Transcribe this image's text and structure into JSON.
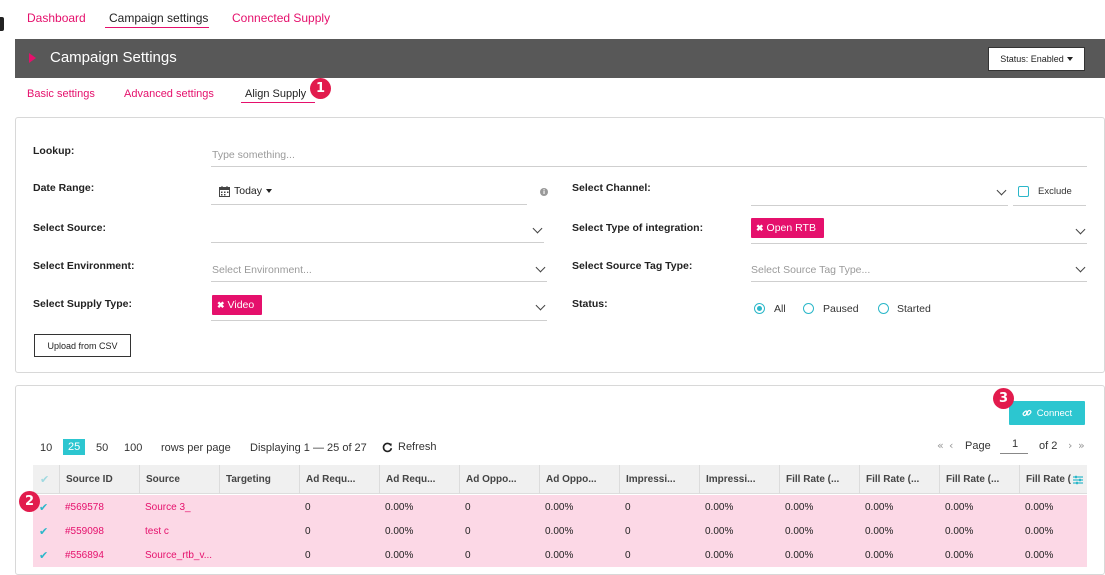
{
  "top_nav": {
    "dashboard": "Dashboard",
    "campaign_settings": "Campaign settings",
    "connected_supply": "Connected Supply"
  },
  "header": {
    "title": "Campaign Settings",
    "status_button": "Status: Enabled"
  },
  "sub_tabs": {
    "basic": "Basic settings",
    "advanced": "Advanced settings",
    "align_supply": "Align Supply"
  },
  "markers": {
    "m1": "1",
    "m2": "2",
    "m3": "3"
  },
  "filters": {
    "lookup_label": "Lookup:",
    "lookup_placeholder": "Type something...",
    "date_range_label": "Date Range:",
    "date_range_value": "Today",
    "select_source_label": "Select Source:",
    "select_environment_label": "Select Environment:",
    "select_environment_placeholder": "Select Environment...",
    "select_supply_type_label": "Select Supply Type:",
    "supply_type_tag": "Video",
    "select_channel_label": "Select Channel:",
    "exclude_label": "Exclude",
    "select_integration_label": "Select Type of integration:",
    "integration_tag": "Open RTB",
    "select_source_tag_type_label": "Select Source Tag Type:",
    "select_source_tag_type_placeholder": "Select Source Tag Type...",
    "status_label": "Status:",
    "status_options": [
      "All",
      "Paused",
      "Started"
    ],
    "status_selected": "All",
    "upload_csv": "Upload from CSV"
  },
  "table_controls": {
    "connect_button": "Connect",
    "rows_per_page_options": [
      "10",
      "25",
      "50",
      "100"
    ],
    "rows_per_page_selected": "25",
    "rows_per_page_label": "rows per page",
    "displaying": "Displaying 1 — 25 of 27",
    "refresh": "Refresh",
    "page_label": "Page",
    "page_value": "1",
    "page_of": "of 2"
  },
  "table": {
    "columns": [
      "Source ID",
      "Source",
      "Targeting",
      "Ad Requ...",
      "Ad Requ...",
      "Ad Oppo...",
      "Ad Oppo...",
      "Impressi...",
      "Impressi...",
      "Fill Rate (...",
      "Fill Rate (...",
      "Fill Rate (...",
      "Fill Rate (..."
    ],
    "rows": [
      [
        "#569578",
        "Source 3_",
        "",
        "0",
        "0.00%",
        "0",
        "0.00%",
        "0",
        "0.00%",
        "0.00%",
        "0.00%",
        "0.00%",
        "0.00%"
      ],
      [
        "#559098",
        "test c",
        "",
        "0",
        "0.00%",
        "0",
        "0.00%",
        "0",
        "0.00%",
        "0.00%",
        "0.00%",
        "0.00%",
        "0.00%"
      ],
      [
        "#556894",
        "Source_rtb_v...",
        "",
        "0",
        "0.00%",
        "0",
        "0.00%",
        "0",
        "0.00%",
        "0.00%",
        "0.00%",
        "0.00%",
        "0.00%"
      ]
    ]
  },
  "colors": {
    "accent_pink": "#e5106c",
    "accent_teal": "#2cc6d0",
    "header_gray": "#585858",
    "row_highlight": "#fcd8e6",
    "marker_red": "#e21b4d"
  },
  "icons": {
    "calendar": "calendar-icon",
    "refresh": "refresh-icon",
    "link": "link-icon",
    "column_settings": "column-settings-icon"
  }
}
